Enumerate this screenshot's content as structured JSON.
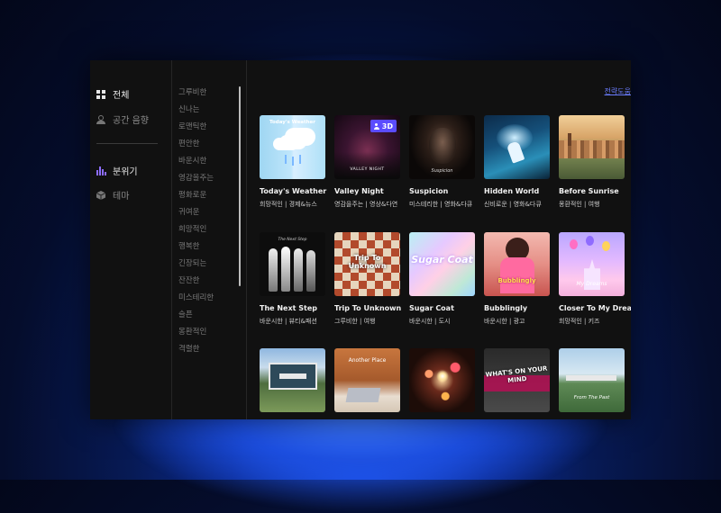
{
  "nav": {
    "items": [
      {
        "label": "전체",
        "icon": "grid-icon"
      },
      {
        "label": "공간 음향",
        "icon": "person-audio-icon"
      },
      {
        "label": "분위기",
        "icon": "bars-icon"
      },
      {
        "label": "테마",
        "icon": "cube-icon"
      }
    ]
  },
  "moods": [
    "그루비한",
    "신나는",
    "로맨틱한",
    "편안한",
    "바운시한",
    "영감을주는",
    "평화로운",
    "귀여운",
    "희망적인",
    "행복한",
    "긴장되는",
    "잔잔한",
    "미스테리한",
    "슬픈",
    "몽환적인",
    "격렬한"
  ],
  "more_link": "전략도움",
  "badge": {
    "label": "3D",
    "icon": "person-icon",
    "color": "#5b4cff"
  },
  "cards": [
    {
      "title": "Today's Weather",
      "tags": "희망적인 | 경제&뉴스",
      "art_text": "Today's Weather"
    },
    {
      "title": "Valley Night",
      "tags": "영감을주는 | 영상&다연",
      "art_text": "VALLEY NIGHT"
    },
    {
      "title": "Suspicion",
      "tags": "미스테리한 | 영화&다큐",
      "art_text": "Suspicion"
    },
    {
      "title": "Hidden World",
      "tags": "신비로운 | 영화&다큐",
      "art_text": ""
    },
    {
      "title": "Before Sunrise",
      "tags": "몽환적인 | 여행",
      "art_text": ""
    },
    {
      "title": "The Next Step",
      "tags": "바운시한 | 뷰티&패션",
      "art_text": "The Next Step"
    },
    {
      "title": "Trip To Unknown",
      "tags": "그루비한 | 여행",
      "art_text": "Trip To Unknown"
    },
    {
      "title": "Sugar Coat",
      "tags": "바운시한 | 도시",
      "art_text": "Sugar Coat"
    },
    {
      "title": "Bubblingly",
      "tags": "바운시한 | 광고",
      "art_text": "Bubblingly"
    },
    {
      "title": "Closer To My Dreams",
      "tags": "희망적인 | 키즈",
      "art_text": "My Dreams"
    },
    {
      "title": "",
      "tags": "",
      "art_text": ""
    },
    {
      "title": "",
      "tags": "",
      "art_text": "Another Place"
    },
    {
      "title": "",
      "tags": "",
      "art_text": ""
    },
    {
      "title": "",
      "tags": "",
      "art_text": "WHAT'S ON YOUR MIND"
    },
    {
      "title": "",
      "tags": "",
      "art_text": "From The Past"
    }
  ]
}
